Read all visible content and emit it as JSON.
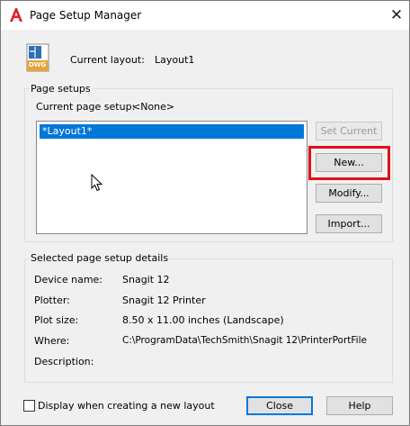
{
  "window": {
    "title": "Page Setup Manager",
    "close_glyph": "✕"
  },
  "current_layout": {
    "label": "Current layout:",
    "value": "Layout1",
    "icon_label": "DWG"
  },
  "page_setups": {
    "group_title": "Page setups",
    "current_label": "Current page setup:",
    "current_value": "<None>",
    "list_items": [
      "*Layout1*"
    ],
    "selected_index": 0
  },
  "buttons": {
    "set_current": "Set Current",
    "new": "New...",
    "modify": "Modify...",
    "import": "Import...",
    "close": "Close",
    "help": "Help"
  },
  "details": {
    "group_title": "Selected page setup details",
    "rows": [
      {
        "label": "Device name:",
        "value": "Snagit 12"
      },
      {
        "label": "Plotter:",
        "value": "Snagit 12 Printer"
      },
      {
        "label": "Plot size:",
        "value": "8.50 x 11.00 inches (Landscape)"
      },
      {
        "label": "Where:",
        "value": "C:\\ProgramData\\TechSmith\\Snagit 12\\PrinterPortFile"
      },
      {
        "label": "Description:",
        "value": ""
      }
    ]
  },
  "footer": {
    "checkbox_label": "Display when creating a new layout",
    "checkbox_checked": false
  },
  "colors": {
    "selection": "#0078d7",
    "highlight_annotation": "#e0101a",
    "app_icon": "#d9262c"
  }
}
